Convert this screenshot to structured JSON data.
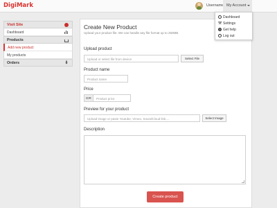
{
  "header": {
    "brand": "DigiMark",
    "username": "Username",
    "account_label": "My Account"
  },
  "account_menu": {
    "items": [
      {
        "label": "Dashboard",
        "icon": "dashboard-icon"
      },
      {
        "label": "Settings",
        "icon": "wrench-icon"
      },
      {
        "label": "Get help",
        "icon": "help-icon"
      },
      {
        "label": "Log out",
        "icon": "power-icon"
      }
    ]
  },
  "sidebar": {
    "visit_site": "Visit Site",
    "dashboard": "Dashboard",
    "products": "Products",
    "add_new_product": "Add new product",
    "my_products": "My products",
    "orders": "Orders"
  },
  "form": {
    "title": "Create New Product",
    "subtitle": "Upload your product file. We can handle any file format up to 250MB.",
    "upload_label": "Upload product",
    "upload_placeholder": "Upload or select file from device",
    "select_file_button": "Select File",
    "name_label": "Product name",
    "name_placeholder": "Product name",
    "price_label": "Price",
    "currency": "IDR",
    "price_placeholder": "Product price",
    "preview_label": "Preview for your product",
    "preview_placeholder": "Upload image or paste Youtube, Vimeo, SoundCloud link,...",
    "select_image_button": "Select Image",
    "description_label": "Description",
    "submit_button": "Create product"
  },
  "colors": {
    "brand": "#d9322e",
    "primary_button": "#d9534f",
    "active_sidebar": "#c9302c"
  }
}
